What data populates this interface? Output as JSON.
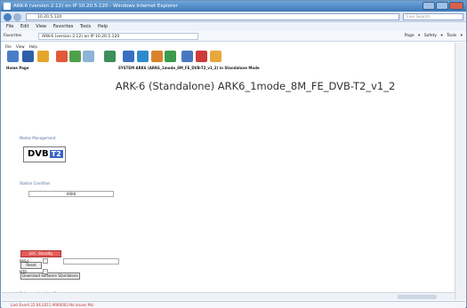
{
  "window": {
    "title": "ARK-6 (version 2.12) on IP 10.20.5.120 - Windows Internet Explorer"
  },
  "address": {
    "url": "10.20.5.120",
    "search_placeholder": "Live Search"
  },
  "menubar": [
    "File",
    "Edit",
    "View",
    "Favorites",
    "Tools",
    "Help"
  ],
  "favorites": {
    "label": "Favorites",
    "tab": "ARK-6 (version 2.12) on IP 10.20.5.120",
    "tools": "Page ▾  Safety ▾  Tools ▾"
  },
  "app_menu": [
    "File",
    "View",
    "Help"
  ],
  "labels": {
    "home": "Home Page",
    "system": "SYSTEM ARK6 (ARK6_1mode_8M_FE_DVB-T2_v1_2) in Standalone Mode"
  },
  "page_title": "ARK-6 (Standalone) ARK6_1mode_8M_FE_DVB-T2_v1_2",
  "sections": {
    "mode": "Modes Management",
    "station": "Station Condition",
    "time": "Reference Locking Status"
  },
  "logo": {
    "dvb": "DVB",
    "t2": "T2"
  },
  "station": {
    "value": "ARK6"
  },
  "buttons": {
    "ext": "LOC. Standby",
    "reset": "Reset",
    "download": "Download Software Standalone"
  },
  "rows": {
    "ppsd": "PPSd",
    "ntp": "NTP"
  },
  "status": {
    "text": "Last Event 22.04.2011 ARK6003 No Issues Msi"
  }
}
